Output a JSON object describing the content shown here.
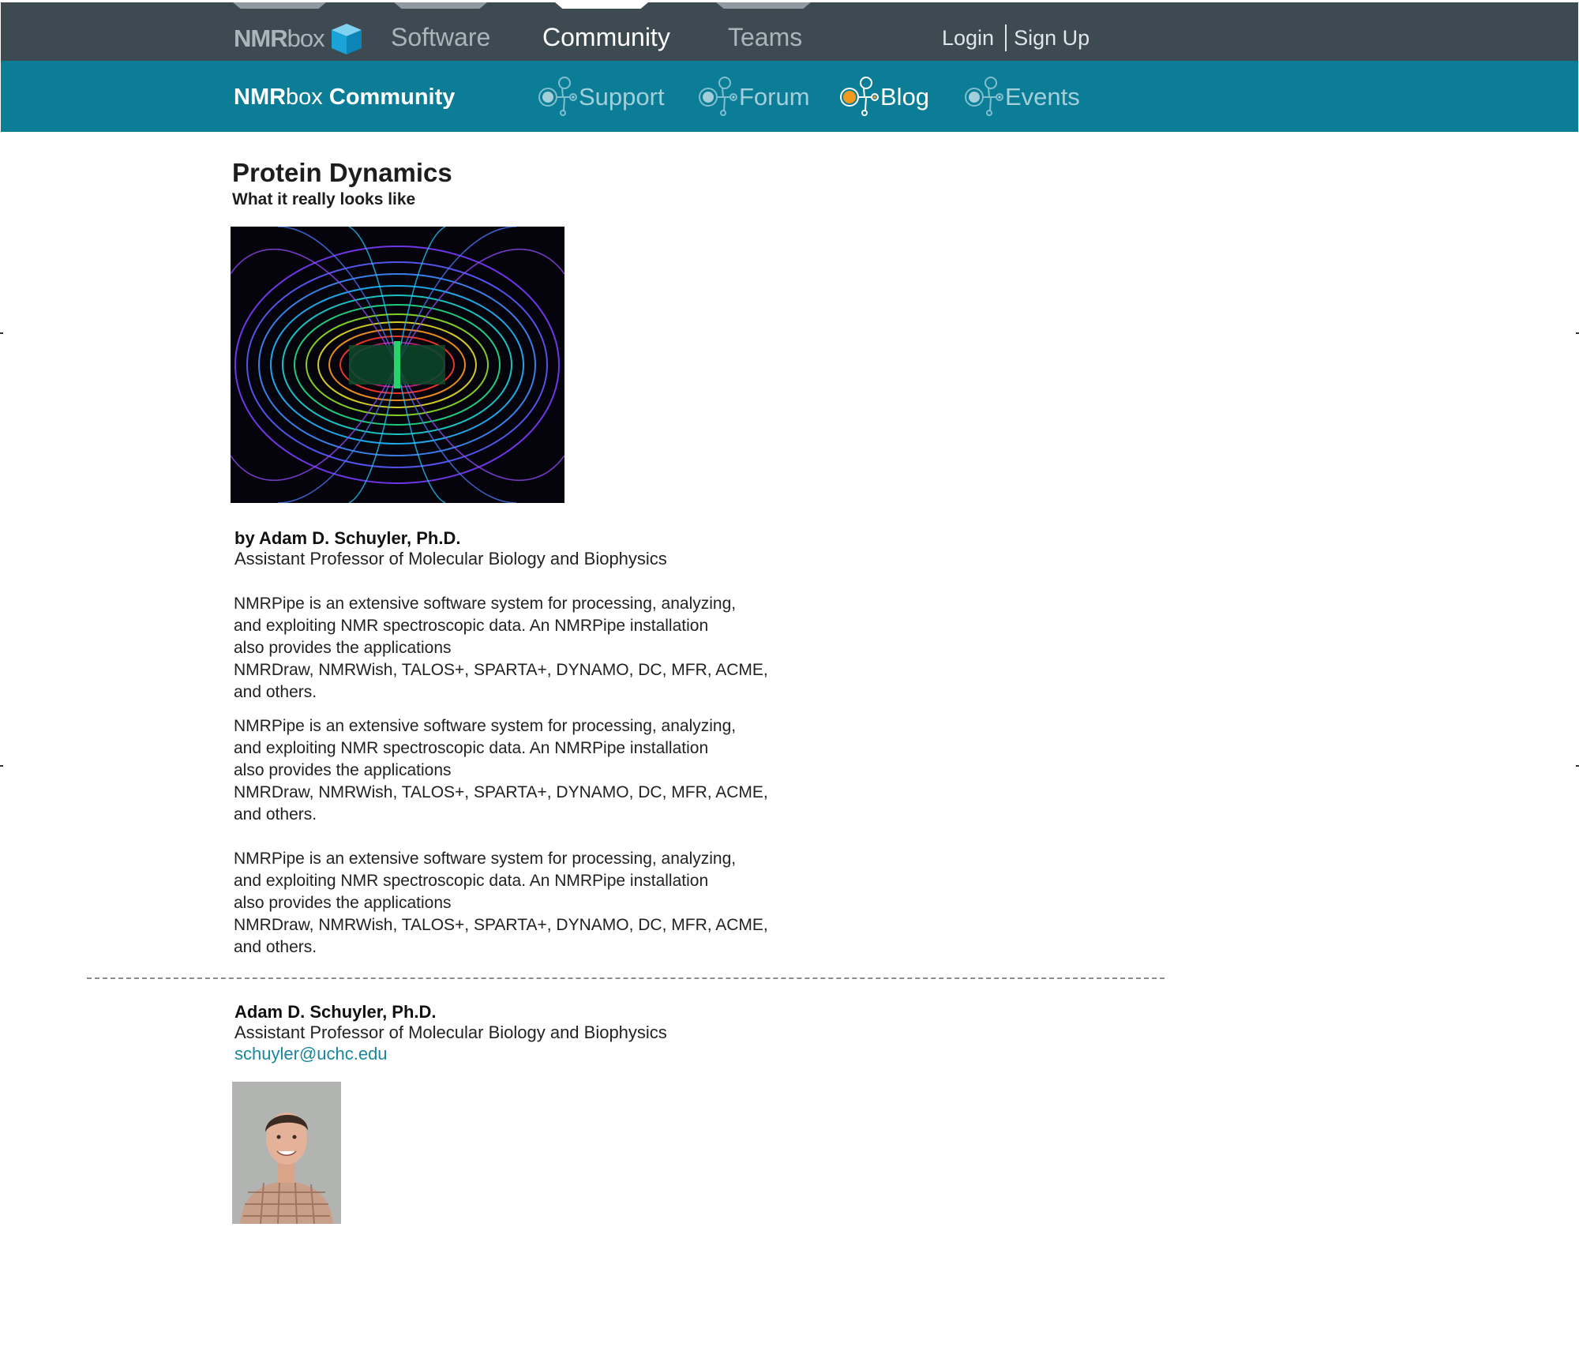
{
  "topbar": {
    "logo_bold": "NMR",
    "logo_light": "box",
    "nav": [
      {
        "label": "Software"
      },
      {
        "label": "Community",
        "active": true
      },
      {
        "label": "Teams"
      }
    ],
    "login": "Login",
    "signup": "Sign Up"
  },
  "subbar": {
    "brand_bold": "NMR",
    "brand_light": "box",
    "brand_suffix": " Community",
    "links": [
      {
        "label": "Support"
      },
      {
        "label": "Forum"
      },
      {
        "label": "Blog",
        "active": true
      },
      {
        "label": "Events"
      }
    ]
  },
  "article": {
    "title": "Protein Dynamics",
    "subtitle": "What it really looks like",
    "byline": "by Adam D. Schuyler, Ph.D.",
    "role": "Assistant Professor of Molecular Biology and Biophysics",
    "paragraphs": [
      {
        "lines": [
          "NMRPipe is an extensive software system for processing, analyzing,",
          "and exploiting NMR spectroscopic data. An NMRPipe installation",
          "also provides the applications",
          "NMRDraw, NMRWish, TALOS+, SPARTA+, DYNAMO, DC, MFR, ACME,",
          "and others."
        ]
      },
      {
        "lines": [
          "NMRPipe is an extensive software system for processing, analyzing,",
          "and exploiting NMR spectroscopic data. An NMRPipe installation",
          "also provides the applications",
          "NMRDraw, NMRWish, TALOS+, SPARTA+, DYNAMO, DC, MFR, ACME,",
          "and others."
        ]
      },
      {
        "lines": [
          "NMRPipe is an extensive software system for processing, analyzing,",
          "and exploiting NMR spectroscopic data. An NMRPipe installation",
          "also provides the applications",
          "NMRDraw, NMRWish, TALOS+, SPARTA+, DYNAMO, DC, MFR, ACME,",
          "and others."
        ]
      }
    ]
  },
  "bio": {
    "name": "Adam D. Schuyler, Ph.D.",
    "role": "Assistant Professor of Molecular Biology and Biophysics",
    "email": "schuyler@uchc.edu"
  },
  "colors": {
    "topbar": "#3d4a51",
    "subbar": "#0b7d96",
    "active_dot": "#f39a1e",
    "link": "#1a86a0"
  },
  "icons": {
    "logo": "cube-icon",
    "sub_links": "molecule-node-icon"
  }
}
